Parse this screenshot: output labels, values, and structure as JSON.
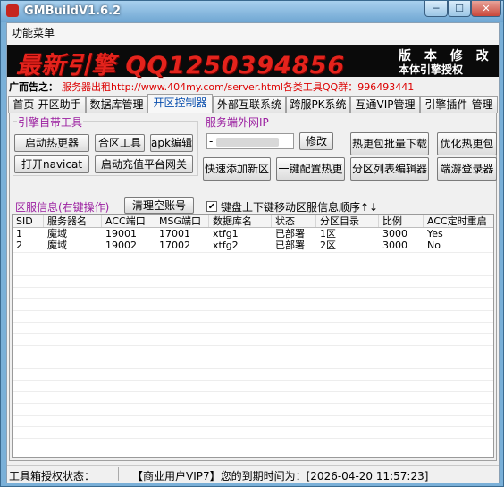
{
  "window": {
    "title": "GMBuildV1.6.2",
    "min_label": "─",
    "max_label": "☐",
    "close_label": "✕"
  },
  "menu": {
    "items": [
      "功能菜单"
    ]
  },
  "banner": {
    "main_text": "最新引擎 QQ1250394856",
    "right_line1": "版 本 修 改",
    "right_line2": "本体引擎授权"
  },
  "ad": {
    "label": "广而告之：",
    "text": "服务器出租http://www.404my.com/server.html各类工具QQ群：996493441"
  },
  "tabs": [
    {
      "label": "首页-开区助手"
    },
    {
      "label": "数据库管理"
    },
    {
      "label": "开区控制器"
    },
    {
      "label": "外部互联系统"
    },
    {
      "label": "跨服PK系统"
    },
    {
      "label": "互通VIP管理"
    },
    {
      "label": "引擎插件-管理"
    }
  ],
  "engine_tools": {
    "title": "引擎自带工具",
    "buttons": [
      "启动热更器",
      "合区工具",
      "apk编辑",
      "打开navicat",
      "启动充值平台网关"
    ]
  },
  "server_ip": {
    "title": "服务端外网IP",
    "value": "-",
    "modify_label": "修改"
  },
  "right_buttons": [
    "热更包批量下载",
    "优化热更包",
    "快速添加新区",
    "一键配置热更",
    "分区列表编辑器",
    "端游登录器"
  ],
  "zone_info": {
    "title": "区服信息(右键操作)",
    "clear_button": "清理空账号",
    "checkbox_checked": true,
    "checkbox_mark": "✔",
    "checkbox_label": "键盘上下键移动区服信息顺序↑↓"
  },
  "table": {
    "columns": [
      "SID",
      "服务器名",
      "ACC端口",
      "MSG端口",
      "数据库名",
      "状态",
      "分区目录",
      "比例",
      "ACC定时重启"
    ],
    "rows": [
      [
        "1",
        "魔域",
        "19001",
        "17001",
        "xtfg1",
        "已部署",
        "1区",
        "3000",
        "Yes"
      ],
      [
        "2",
        "魔域",
        "19002",
        "17002",
        "xtfg2",
        "已部署",
        "2区",
        "3000",
        "No"
      ]
    ]
  },
  "status": {
    "label": "工具箱授权状态：",
    "text": "【商业用户VIP7】您的到期时间为：[2026-04-20 11:57:23]"
  }
}
